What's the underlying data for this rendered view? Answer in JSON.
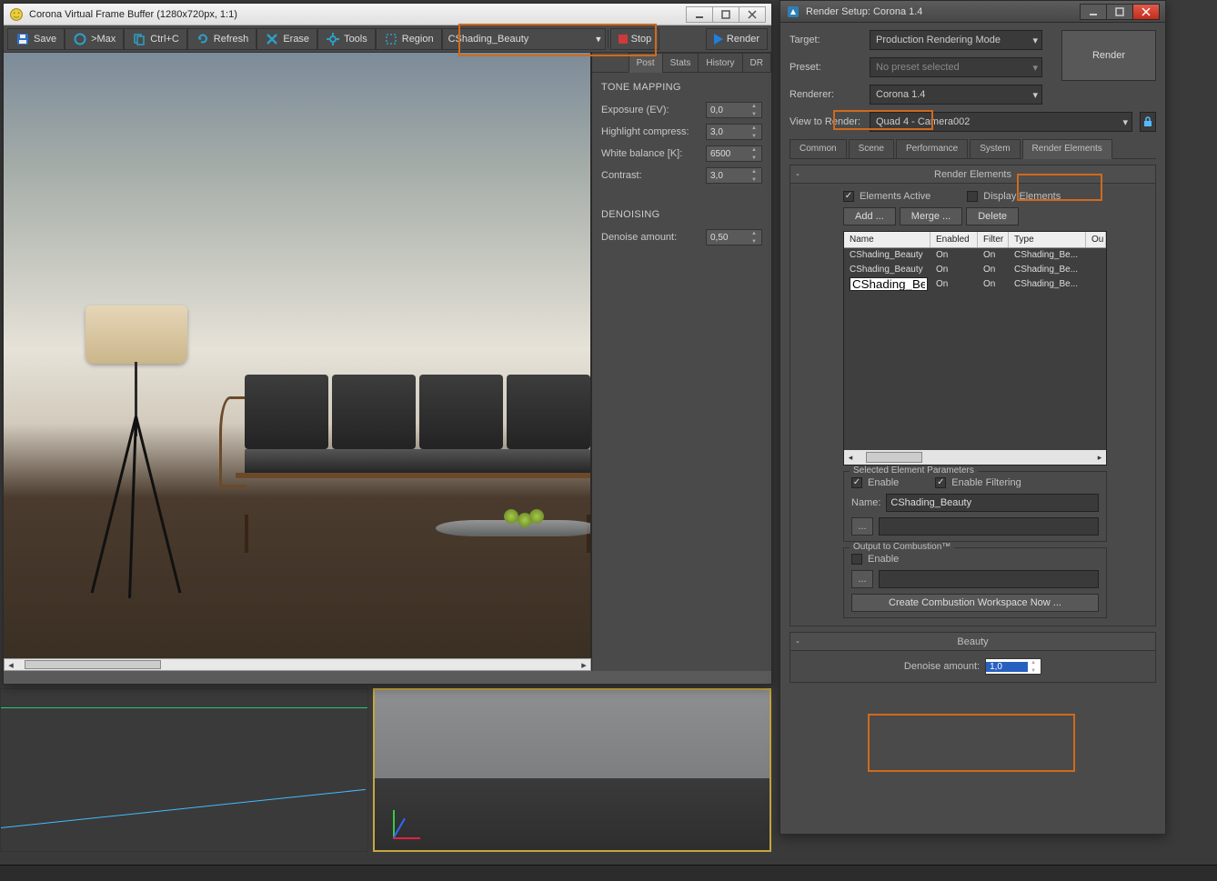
{
  "vfb": {
    "title": "Corona Virtual Frame Buffer (1280x720px, 1:1)",
    "toolbar": {
      "save": "Save",
      "max": ">Max",
      "copy": "Ctrl+C",
      "refresh": "Refresh",
      "erase": "Erase",
      "tools": "Tools",
      "region": "Region",
      "channel": "CShading_Beauty",
      "stop": "Stop",
      "render": "Render"
    },
    "tabs": {
      "post": "Post",
      "stats": "Stats",
      "history": "History",
      "dr": "DR"
    },
    "tonemap": {
      "header": "TONE MAPPING",
      "exposure_lbl": "Exposure (EV):",
      "exposure": "0,0",
      "highlight_lbl": "Highlight compress:",
      "highlight": "3,0",
      "wb_lbl": "White balance [K]:",
      "wb": "6500",
      "contrast_lbl": "Contrast:",
      "contrast": "3,0"
    },
    "denoise": {
      "header": "DENOISING",
      "amount_lbl": "Denoise amount:",
      "amount": "0,50"
    }
  },
  "rs": {
    "title": "Render Setup: Corona 1.4",
    "target_lbl": "Target:",
    "target": "Production Rendering Mode",
    "preset_lbl": "Preset:",
    "preset": "No preset selected",
    "renderer_lbl": "Renderer:",
    "renderer": "Corona 1.4",
    "view_lbl": "View to Render:",
    "view": "Quad 4 - Camera002",
    "render_btn": "Render",
    "tabs": {
      "common": "Common",
      "scene": "Scene",
      "perf": "Performance",
      "system": "System",
      "elems": "Render Elements"
    },
    "rollout": "Render Elements",
    "elems_active": "Elements Active",
    "display_elems": "Display Elements",
    "add": "Add ...",
    "merge": "Merge ...",
    "delete": "Delete",
    "th": {
      "name": "Name",
      "en": "Enabled",
      "fi": "Filter",
      "ty": "Type",
      "ou": "Ou"
    },
    "rows": [
      {
        "name": "CShading_Beauty",
        "en": "On",
        "fi": "On",
        "ty": "CShading_Be..."
      },
      {
        "name": "CShading_Beauty",
        "en": "On",
        "fi": "On",
        "ty": "CShading_Be..."
      },
      {
        "name": "CShading_Beauty",
        "en": "On",
        "fi": "On",
        "ty": "CShading_Be..."
      }
    ],
    "sel": {
      "legend": "Selected Element Parameters",
      "enable": "Enable",
      "filter": "Enable Filtering",
      "name_lbl": "Name:",
      "name": "CShading_Beauty",
      "dots": "..."
    },
    "comb": {
      "legend": "Output to Combustion™",
      "enable": "Enable",
      "dots": "...",
      "create": "Create Combustion Workspace Now ..."
    },
    "beauty": {
      "title": "Beauty",
      "denoise_lbl": "Denoise amount:",
      "denoise": "1,0"
    }
  }
}
